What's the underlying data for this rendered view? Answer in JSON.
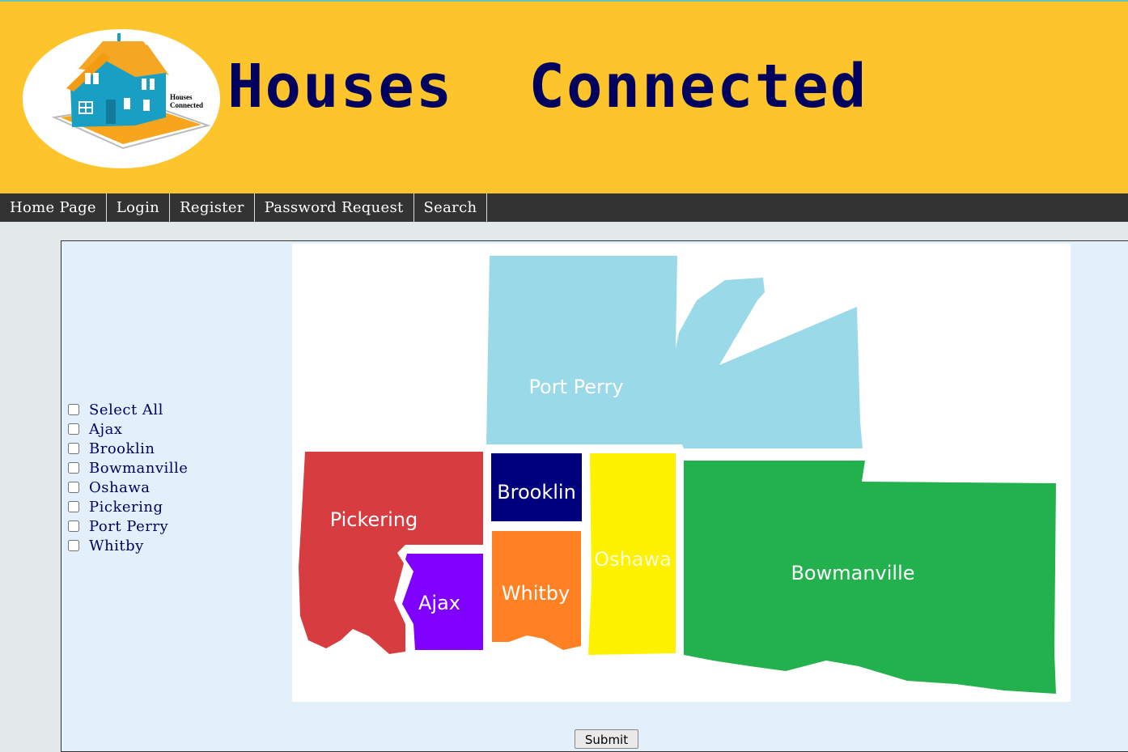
{
  "header": {
    "title": "Houses  Connected",
    "logo_text_line1": "Houses",
    "logo_text_line2": "Connected"
  },
  "nav": {
    "items": [
      "Home Page",
      "Login",
      "Register",
      "Password Request",
      "Search"
    ]
  },
  "areas": {
    "select_all": "Select All",
    "items": [
      "Ajax",
      "Brooklin",
      "Bowmanville",
      "Oshawa",
      "Pickering",
      "Port Perry",
      "Whitby"
    ]
  },
  "map": {
    "labels": {
      "port_perry": "Port Perry",
      "brooklin": "Brooklin",
      "pickering": "Pickering",
      "ajax": "Ajax",
      "whitby": "Whitby",
      "oshawa": "Oshawa",
      "bowmanville": "Bowmanville"
    },
    "colors": {
      "port_perry": "#9ad9e8",
      "brooklin": "#00007e",
      "pickering": "#d63c40",
      "ajax": "#8000ff",
      "whitby": "#ff8123",
      "oshawa": "#fff200",
      "bowmanville": "#22b14c"
    }
  },
  "form": {
    "submit_label": "Submit"
  },
  "colors": {
    "header_bg": "#fec42b",
    "title_color": "#00005f",
    "nav_bg": "#333333",
    "panel_bg": "#e3f0fc"
  }
}
